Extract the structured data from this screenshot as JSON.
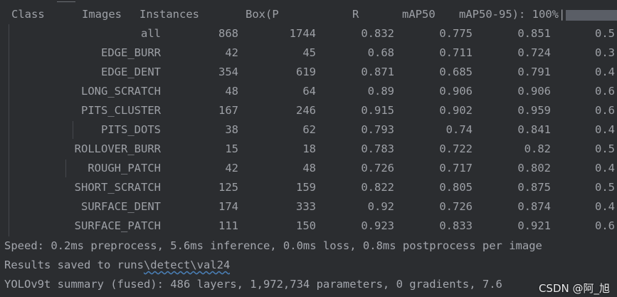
{
  "header": {
    "class": "Class",
    "images": "Images",
    "instances": "Instances",
    "box_p": "Box(P",
    "r": "R",
    "map50": "mAP50",
    "map50_95": "mAP50-95): 100%|"
  },
  "rows": [
    {
      "class": "all",
      "images": "868",
      "instances": "1744",
      "p": "0.832",
      "r": "0.775",
      "map50": "0.851",
      "map50_95": "0.5"
    },
    {
      "class": "EDGE_BURR",
      "images": "42",
      "instances": "45",
      "p": "0.68",
      "r": "0.711",
      "map50": "0.724",
      "map50_95": "0.3"
    },
    {
      "class": "EDGE_DENT",
      "images": "354",
      "instances": "619",
      "p": "0.871",
      "r": "0.685",
      "map50": "0.791",
      "map50_95": "0.4"
    },
    {
      "class": "LONG_SCRATCH",
      "images": "48",
      "instances": "64",
      "p": "0.89",
      "r": "0.906",
      "map50": "0.906",
      "map50_95": "0.6"
    },
    {
      "class": "PITS_CLUSTER",
      "images": "167",
      "instances": "246",
      "p": "0.915",
      "r": "0.902",
      "map50": "0.959",
      "map50_95": "0.6"
    },
    {
      "class": "PITS_DOTS",
      "images": "38",
      "instances": "62",
      "p": "0.793",
      "r": "0.74",
      "map50": "0.841",
      "map50_95": "0.4"
    },
    {
      "class": "ROLLOVER_BURR",
      "images": "15",
      "instances": "18",
      "p": "0.783",
      "r": "0.722",
      "map50": "0.82",
      "map50_95": "0.5"
    },
    {
      "class": "ROUGH_PATCH",
      "images": "42",
      "instances": "48",
      "p": "0.726",
      "r": "0.717",
      "map50": "0.802",
      "map50_95": "0.4"
    },
    {
      "class": "SHORT_SCRATCH",
      "images": "125",
      "instances": "159",
      "p": "0.822",
      "r": "0.805",
      "map50": "0.875",
      "map50_95": "0.5"
    },
    {
      "class": "SURFACE_DENT",
      "images": "174",
      "instances": "333",
      "p": "0.92",
      "r": "0.726",
      "map50": "0.874",
      "map50_95": "0.4"
    },
    {
      "class": "SURFACE_PATCH",
      "images": "111",
      "instances": "150",
      "p": "0.923",
      "r": "0.833",
      "map50": "0.921",
      "map50_95": "0.6"
    }
  ],
  "footer": {
    "speed": "Speed: 0.2ms preprocess, 5.6ms inference, 0.0ms loss, 0.8ms postprocess per image",
    "results_prefix": "Results saved to runs",
    "results_path": "\\detect\\val24",
    "summary": "YOLOv9t summary (fused): 486 layers, 1,972,734 parameters, 0 gradients, 7.6"
  },
  "progress": {
    "percent": 100
  },
  "watermark": "CSDN @阿_旭",
  "colors": {
    "background": "#2b2d30",
    "text": "#9da0a6",
    "progress_bar": "#5a5e66"
  }
}
